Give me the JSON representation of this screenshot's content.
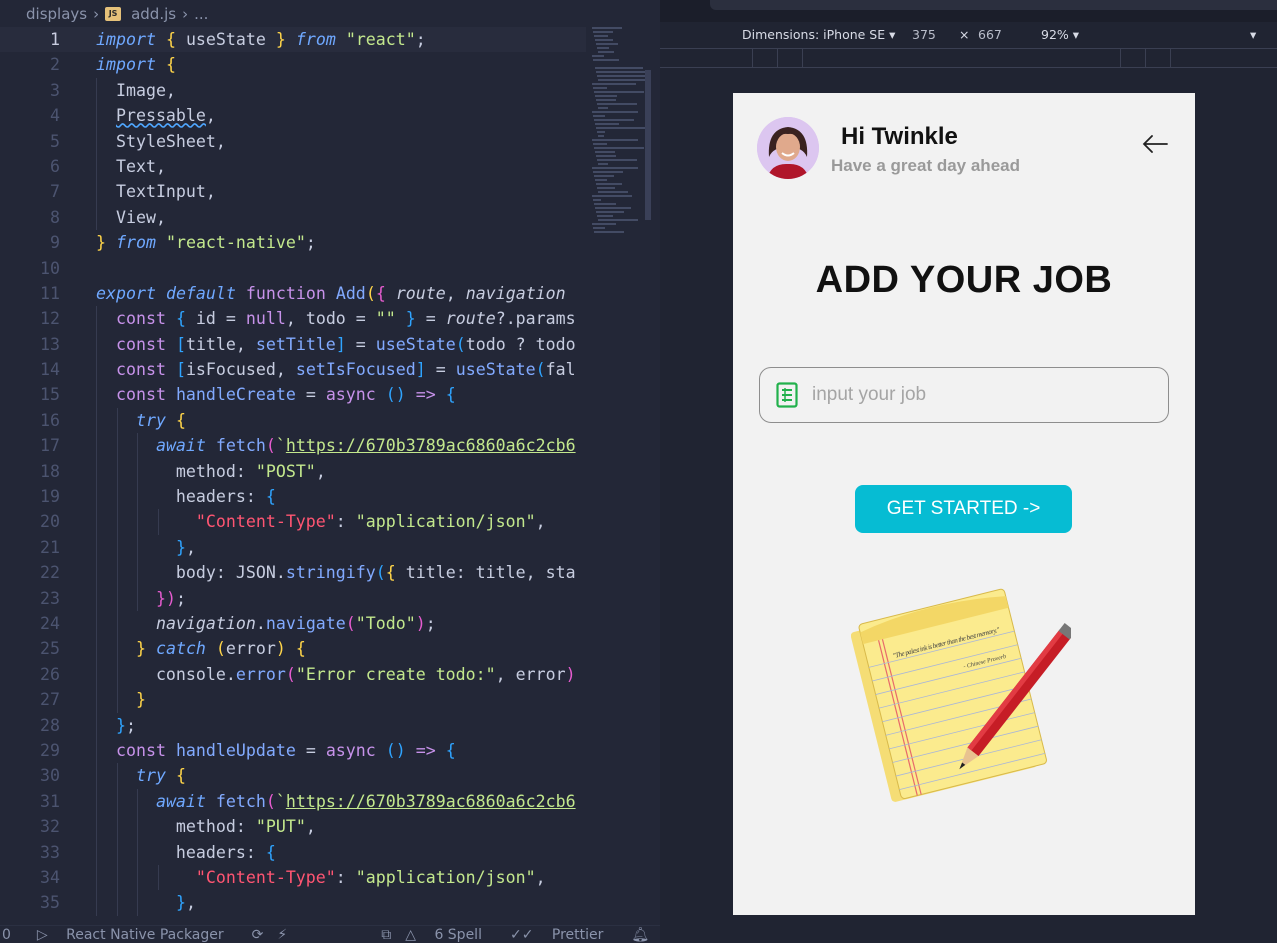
{
  "editor": {
    "breadcrumb": {
      "folder": "displays",
      "file": "add.js",
      "more": "...",
      "js_badge": "JS"
    },
    "lines": [
      {
        "n": "1",
        "html": "<span class='kw'>import</span> <span class='br1'>{</span> useState <span class='br1'>}</span> <span class='kw'>from</span> <span class='str'>\"react\"</span>;",
        "indent": 0,
        "cur": true
      },
      {
        "n": "2",
        "html": "<span class='kw'>import</span> <span class='br1'>{</span>",
        "indent": 0
      },
      {
        "n": "3",
        "html": "  Image,",
        "indent": 1
      },
      {
        "n": "4",
        "html": "  <span class='wavy'>Pressable</span>,",
        "indent": 1
      },
      {
        "n": "5",
        "html": "  StyleSheet,",
        "indent": 1
      },
      {
        "n": "6",
        "html": "  Text,",
        "indent": 1
      },
      {
        "n": "7",
        "html": "  TextInput,",
        "indent": 1
      },
      {
        "n": "8",
        "html": "  View,",
        "indent": 1
      },
      {
        "n": "9",
        "html": "<span class='br1'>}</span> <span class='kw'>from</span> <span class='str'>\"react-native\"</span>;",
        "indent": 0
      },
      {
        "n": "10",
        "html": "",
        "indent": 0
      },
      {
        "n": "11",
        "html": "<span class='kw'>export</span> <span class='kw'>default</span> <span class='kw2'>function</span> <span class='fn'>Add</span><span class='br1'>(</span><span class='br2'>{</span> <span class='prm'>route</span>, <span class='prm'>navigation</span> ",
        "indent": 0
      },
      {
        "n": "12",
        "html": "  <span class='kw2'>const</span> <span class='br3'>{</span> id = <span class='kw2'>null</span>, todo = <span class='str'>\"\"</span> <span class='br3'>}</span> = <span class='prm'>route</span>?.params",
        "indent": 1
      },
      {
        "n": "13",
        "html": "  <span class='kw2'>const</span> <span class='br3'>[</span>title, <span class='fn'>setTitle</span><span class='br3'>]</span> = <span class='fn'>useState</span><span class='br3'>(</span>todo ? todo",
        "indent": 1
      },
      {
        "n": "14",
        "html": "  <span class='kw2'>const</span> <span class='br3'>[</span>isFocused, <span class='fn'>setIsFocused</span><span class='br3'>]</span> = <span class='fn'>useState</span><span class='br3'>(</span>fal",
        "indent": 1
      },
      {
        "n": "15",
        "html": "  <span class='kw2'>const</span> <span class='fn'>handleCreate</span> = <span class='kw2'>async</span> <span class='br3'>()</span> <span class='kw2'>=></span> <span class='br3'>{</span>",
        "indent": 1
      },
      {
        "n": "16",
        "html": "    <span class='kw'>try</span> <span class='br1'>{</span>",
        "indent": 2
      },
      {
        "n": "17",
        "html": "      <span class='kw'>await</span> <span class='fn'>fetch</span><span class='br2'>(</span><span class='str'>`</span><span class='url'>https://670b3789ac6860a6c2cb6</span>",
        "indent": 3
      },
      {
        "n": "18",
        "html": "        method: <span class='str'>\"POST\"</span>,",
        "indent": 3
      },
      {
        "n": "19",
        "html": "        headers: <span class='br3'>{</span>",
        "indent": 3
      },
      {
        "n": "20",
        "html": "          <span class='red'>\"Content-Type\"</span>: <span class='str'>\"application/json\"</span>,",
        "indent": 4
      },
      {
        "n": "21",
        "html": "        <span class='br3'>}</span>,",
        "indent": 3
      },
      {
        "n": "22",
        "html": "        body: JSON.<span class='fn'>stringify</span><span class='br3'>(</span><span class='br1'>{</span> title: title, sta",
        "indent": 3
      },
      {
        "n": "23",
        "html": "      <span class='br2'>})</span>;",
        "indent": 3
      },
      {
        "n": "24",
        "html": "      <span class='prm'>navigation</span>.<span class='fn'>navigate</span><span class='br2'>(</span><span class='str'>\"Todo\"</span><span class='br2'>)</span>;",
        "indent": 2
      },
      {
        "n": "25",
        "html": "    <span class='br1'>}</span> <span class='kw'>catch</span> <span class='br1'>(</span>error<span class='br1'>)</span> <span class='br1'>{</span>",
        "indent": 2
      },
      {
        "n": "26",
        "html": "      console.<span class='fn'>error</span><span class='br2'>(</span><span class='str'>\"Error create todo:\"</span>, error<span class='br2'>)</span>",
        "indent": 2
      },
      {
        "n": "27",
        "html": "    <span class='br1'>}</span>",
        "indent": 2
      },
      {
        "n": "28",
        "html": "  <span class='br3'>}</span>;",
        "indent": 1
      },
      {
        "n": "29",
        "html": "  <span class='kw2'>const</span> <span class='fn'>handleUpdate</span> = <span class='kw2'>async</span> <span class='br3'>()</span> <span class='kw2'>=></span> <span class='br3'>{</span>",
        "indent": 1
      },
      {
        "n": "30",
        "html": "    <span class='kw'>try</span> <span class='br1'>{</span>",
        "indent": 2
      },
      {
        "n": "31",
        "html": "      <span class='kw'>await</span> <span class='fn'>fetch</span><span class='br2'>(</span><span class='str'>`</span><span class='url'>https://670b3789ac6860a6c2cb6</span>",
        "indent": 3
      },
      {
        "n": "32",
        "html": "        method: <span class='str'>\"PUT\"</span>,",
        "indent": 3
      },
      {
        "n": "33",
        "html": "        headers: <span class='br3'>{</span>",
        "indent": 3
      },
      {
        "n": "34",
        "html": "          <span class='red'>\"Content-Type\"</span>: <span class='str'>\"application/json\"</span>,",
        "indent": 4
      },
      {
        "n": "35",
        "html": "        <span class='br3'>}</span>,",
        "indent": 3
      }
    ]
  },
  "status_bar": {
    "left_num": "0",
    "packager": "React Native Packager",
    "spell": "6 Spell",
    "prettier": "Prettier"
  },
  "devtools": {
    "dimensions_label": "Dimensions: iPhone SE",
    "width": "375",
    "times": "×",
    "height": "667",
    "zoom": "92%"
  },
  "app": {
    "greeting": "Hi Twinkle",
    "subtitle": "Have a great day ahead",
    "title": "ADD YOUR JOB",
    "input_placeholder": "input your job",
    "input_value": "",
    "cta_label": "GET STARTED ->",
    "note_quote": "\"The palest ink is better than the best memory.\"",
    "note_attribution": "- Chinese Proverb",
    "accent_color": "#06bcd3"
  }
}
